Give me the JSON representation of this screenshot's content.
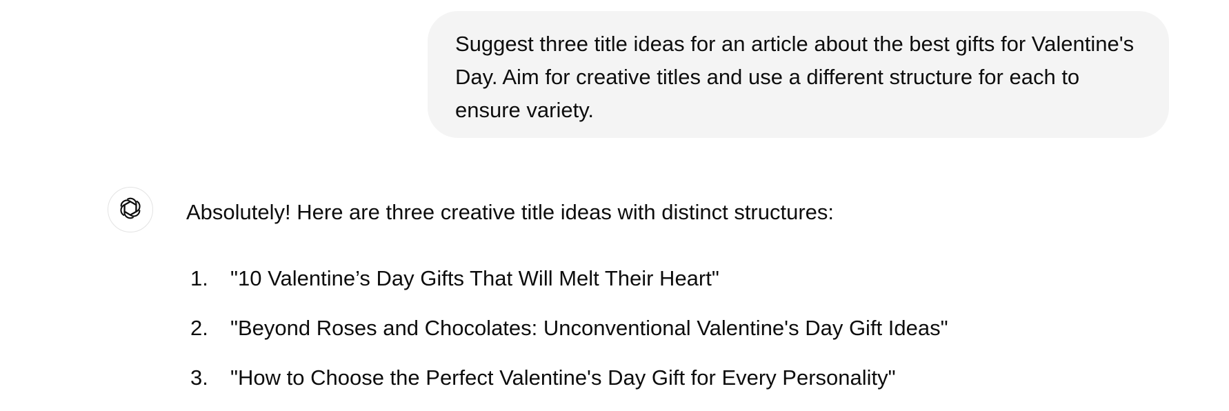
{
  "conversation": {
    "user_message": "Suggest three title ideas for an article about the best gifts for Valentine's Day. Aim for creative titles and use a different structure for each to ensure variety.",
    "assistant": {
      "avatar_icon": "openai-logo-icon",
      "intro": "Absolutely! Here are three creative title ideas with distinct structures:",
      "titles": [
        {
          "number": "1.",
          "text": "\"10 Valentine’s Day Gifts That Will Melt Their Heart\""
        },
        {
          "number": "2.",
          "text": "\"Beyond Roses and Chocolates: Unconventional Valentine's Day Gift Ideas\""
        },
        {
          "number": "3.",
          "text": "\"How to Choose the Perfect Valentine's Day Gift for Every Personality\""
        }
      ]
    }
  },
  "colors": {
    "user_bubble_bg": "#f4f4f4",
    "text": "#0d0d0d",
    "avatar_border": "#e3e3e3"
  }
}
